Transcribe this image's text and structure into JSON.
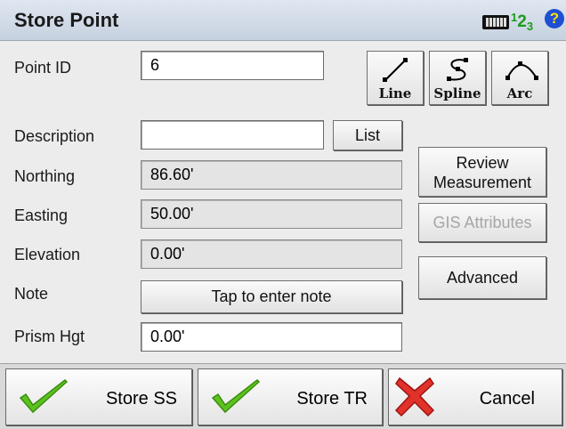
{
  "window": {
    "title": "Store Point",
    "input_mode": {
      "one": "1",
      "two": "2",
      "three": "3"
    },
    "help": "?"
  },
  "fields": {
    "point_id": {
      "label": "Point ID",
      "value": "6"
    },
    "description": {
      "label": "Description",
      "value": ""
    },
    "northing": {
      "label": "Northing",
      "value": "86.60'"
    },
    "easting": {
      "label": "Easting",
      "value": "50.00'"
    },
    "elevation": {
      "label": "Elevation",
      "value": "0.00'"
    },
    "note": {
      "label": "Note",
      "button": "Tap to enter note"
    },
    "prism_hgt": {
      "label": "Prism Hgt",
      "value": "0.00'"
    }
  },
  "geometry_buttons": {
    "line": "Line",
    "spline": "Spline",
    "arc": "Arc"
  },
  "buttons": {
    "list": "List",
    "review_1": "Review",
    "review_2": "Measurement",
    "gis": "GIS Attributes",
    "advanced": "Advanced"
  },
  "bottom_bar": {
    "store_ss": "Store SS",
    "store_tr": "Store TR",
    "cancel": "Cancel"
  },
  "colors": {
    "check": "#5cc21f",
    "cancel_x": "#e0312a",
    "help_bg": "#1f4fd3",
    "numtag": "#1c9a1c"
  },
  "icons": [
    "keyboard-icon",
    "help-icon",
    "line-icon",
    "spline-icon",
    "arc-icon",
    "checkmark-icon",
    "red-x-icon"
  ]
}
